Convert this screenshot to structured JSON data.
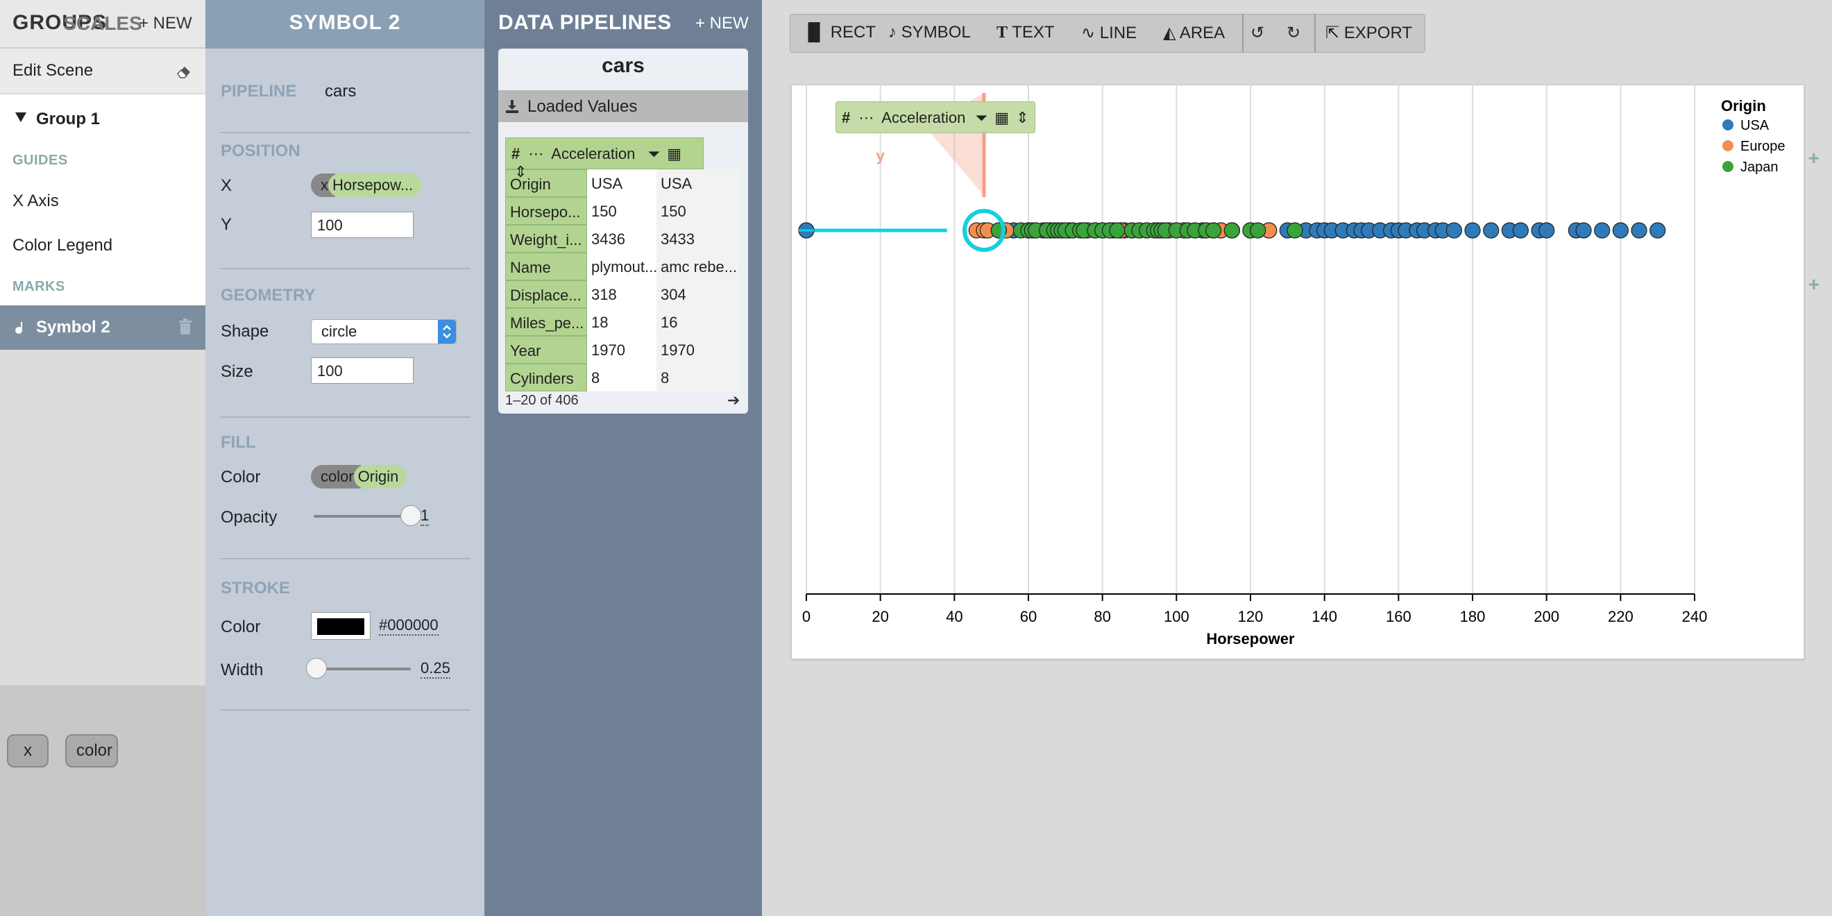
{
  "groups_panel": {
    "title": "GROUPS",
    "new_label": "+ NEW",
    "edit_scene": "Edit Scene",
    "group1": "Group 1",
    "guides_label": "GUIDES",
    "guides": [
      "X Axis",
      "Color Legend"
    ],
    "marks_label": "MARKS",
    "selected_mark": "Symbol 2"
  },
  "scales_panel": {
    "title": "SCALES",
    "scales": [
      "x",
      "color"
    ]
  },
  "inspector": {
    "title": "SYMBOL 2",
    "pipeline_label": "PIPELINE",
    "pipeline_value": "cars",
    "position_label": "POSITION",
    "x_label": "X",
    "x_key": "x",
    "x_value": "Horsepow...",
    "y_label": "Y",
    "y_value": "100",
    "geometry_label": "GEOMETRY",
    "shape_label": "Shape",
    "shape_value": "circle",
    "size_label": "Size",
    "size_value": "100",
    "fill_label": "FILL",
    "fill_color_label": "Color",
    "fill_color_key": "color",
    "fill_color_value": "Origin",
    "opacity_label": "Opacity",
    "opacity_value": "1",
    "opacity_level": 1.0,
    "stroke_label": "STROKE",
    "stroke_color_label": "Color",
    "stroke_color_value": "#000000",
    "stroke_width_label": "Width",
    "stroke_width_value": "0.25",
    "stroke_width_level": 0.025
  },
  "pipelines": {
    "title": "DATA PIPELINES",
    "new_label": "+ NEW",
    "name": "cars",
    "loaded_values": "Loaded Values",
    "field_header": "Acceleration",
    "rows": [
      {
        "key": "Origin",
        "c1": "USA",
        "c2": "USA"
      },
      {
        "key": "Horsepo...",
        "c1": "150",
        "c2": "150"
      },
      {
        "key": "Weight_i...",
        "c1": "3436",
        "c2": "3433"
      },
      {
        "key": "Name",
        "c1": "plymout...",
        "c2": "amc rebe..."
      },
      {
        "key": "Displace...",
        "c1": "318",
        "c2": "304"
      },
      {
        "key": "Miles_pe...",
        "c1": "18",
        "c2": "16"
      },
      {
        "key": "Year",
        "c1": "1970",
        "c2": "1970"
      },
      {
        "key": "Cylinders",
        "c1": "8",
        "c2": "8"
      }
    ],
    "pager": "1–20 of 406"
  },
  "toolbar": {
    "rect": "RECT",
    "symbol": "SYMBOL",
    "text": "TEXT",
    "line": "LINE",
    "area": "AREA",
    "export": "EXPORT"
  },
  "canvas": {
    "floating_field": "Acceleration",
    "y_handle_label": "y"
  },
  "colors": {
    "usa": "#2f7ab9",
    "europe": "#f28e4f",
    "japan": "#3aa33a",
    "selection": "#14d0e0",
    "drop_zone": "#f4a08a"
  },
  "chart_data": {
    "type": "scatter",
    "xlabel": "Horsepower",
    "xlim": [
      0,
      240
    ],
    "x_ticks": [
      "0",
      "20",
      "40",
      "60",
      "80",
      "100",
      "120",
      "140",
      "160",
      "180",
      "200",
      "220",
      "240"
    ],
    "grid": true,
    "legend_title": "Origin",
    "legend_position": "top-right",
    "series": [
      {
        "name": "USA",
        "color": "#2f7ab9",
        "x": [
          0,
          56,
          60,
          62,
          64,
          66,
          70,
          72,
          75,
          78,
          80,
          82,
          85,
          86,
          88,
          90,
          92,
          95,
          98,
          100,
          102,
          105,
          107,
          110,
          112,
          115,
          120,
          125,
          130,
          135,
          138,
          140,
          142,
          145,
          148,
          150,
          152,
          155,
          158,
          160,
          162,
          165,
          167,
          170,
          172,
          175,
          180,
          185,
          190,
          193,
          198,
          200,
          208,
          210,
          215,
          220,
          225,
          230
        ]
      },
      {
        "name": "Europe",
        "color": "#f28e4f",
        "x": [
          46,
          48,
          49,
          52,
          53,
          54,
          60,
          65,
          67,
          70,
          71,
          75,
          76,
          78,
          80,
          83,
          85,
          88,
          90,
          95,
          97,
          98,
          102,
          103,
          108,
          110,
          112,
          115,
          120,
          125
        ]
      },
      {
        "name": "Japan",
        "color": "#3aa33a",
        "x": [
          52,
          58,
          60,
          61,
          62,
          65,
          67,
          68,
          69,
          70,
          72,
          74,
          75,
          78,
          80,
          82,
          84,
          88,
          90,
          92,
          94,
          95,
          96,
          97,
          100,
          103,
          105,
          108,
          110,
          115,
          120,
          122,
          132
        ]
      }
    ]
  }
}
